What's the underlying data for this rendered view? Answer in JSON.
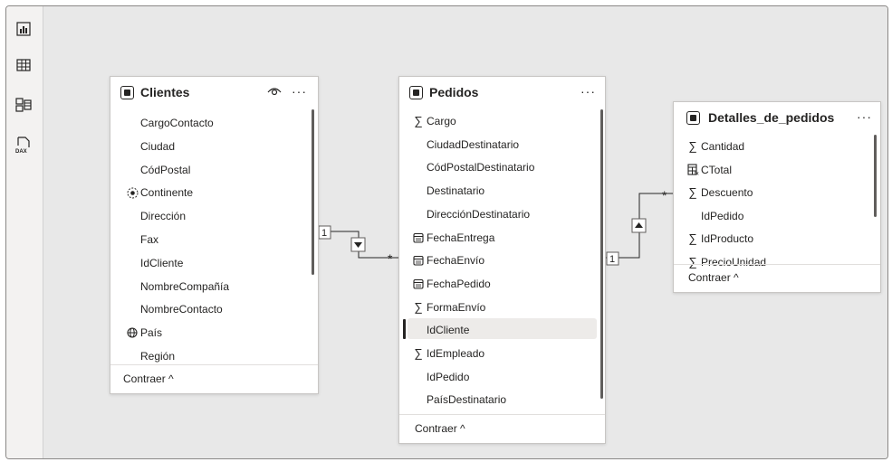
{
  "left_toolbar": {
    "icons": [
      "report-view-icon",
      "table-view-icon",
      "model-view-icon",
      "dax-query-view-icon"
    ],
    "dax_label": "DAX"
  },
  "tables": {
    "clientes": {
      "title": "Clientes",
      "fields": [
        {
          "name": "CargoContacto",
          "icon": ""
        },
        {
          "name": "Ciudad",
          "icon": ""
        },
        {
          "name": "CódPostal",
          "icon": ""
        },
        {
          "name": "Continente",
          "icon": "hierarchy"
        },
        {
          "name": "Dirección",
          "icon": ""
        },
        {
          "name": "Fax",
          "icon": ""
        },
        {
          "name": "IdCliente",
          "icon": ""
        },
        {
          "name": "NombreCompañía",
          "icon": ""
        },
        {
          "name": "NombreContacto",
          "icon": ""
        },
        {
          "name": "País",
          "icon": "globe"
        },
        {
          "name": "Región",
          "icon": ""
        }
      ],
      "collapse_label": "Contraer ^"
    },
    "pedidos": {
      "title": "Pedidos",
      "fields": [
        {
          "name": "Cargo",
          "icon": "sigma"
        },
        {
          "name": "CiudadDestinatario",
          "icon": ""
        },
        {
          "name": "CódPostalDestinatario",
          "icon": ""
        },
        {
          "name": "Destinatario",
          "icon": ""
        },
        {
          "name": "DirecciónDestinatario",
          "icon": ""
        },
        {
          "name": "FechaEntrega",
          "icon": "calendar"
        },
        {
          "name": "FechaEnvío",
          "icon": "calendar"
        },
        {
          "name": "FechaPedido",
          "icon": "calendar"
        },
        {
          "name": "FormaEnvío",
          "icon": "sigma"
        },
        {
          "name": "IdCliente",
          "icon": ""
        },
        {
          "name": "IdEmpleado",
          "icon": "sigma"
        },
        {
          "name": "IdPedido",
          "icon": ""
        },
        {
          "name": "PaísDestinatario",
          "icon": ""
        }
      ],
      "selected_field": "IdCliente",
      "collapse_label": "Contraer ^"
    },
    "detalles": {
      "title": "Detalles_de_pedidos",
      "fields": [
        {
          "name": "Cantidad",
          "icon": "sigma"
        },
        {
          "name": "CTotal",
          "icon": "calculator"
        },
        {
          "name": "Descuento",
          "icon": "sigma"
        },
        {
          "name": "IdPedido",
          "icon": ""
        },
        {
          "name": "IdProducto",
          "icon": "sigma"
        },
        {
          "name": "PrecioUnidad",
          "icon": "sigma"
        }
      ],
      "collapse_label": "Contraer ^"
    }
  },
  "relationships": [
    {
      "from": "Clientes",
      "to": "Pedidos",
      "from_cardinality": "1",
      "to_cardinality": "*",
      "direction": "down"
    },
    {
      "from": "Pedidos",
      "to": "Detalles_de_pedidos",
      "from_cardinality": "1",
      "to_cardinality": "*",
      "direction": "up"
    }
  ],
  "glyphs": {
    "more": "···",
    "sigma": "∑",
    "globe": "🌐",
    "hierarchy": "⦿",
    "calendar": "▤",
    "calculator": "▦"
  },
  "colors": {
    "canvas": "#e8e8e8",
    "card": "#ffffff",
    "text": "#252423",
    "selected_row": "#edebe9"
  }
}
